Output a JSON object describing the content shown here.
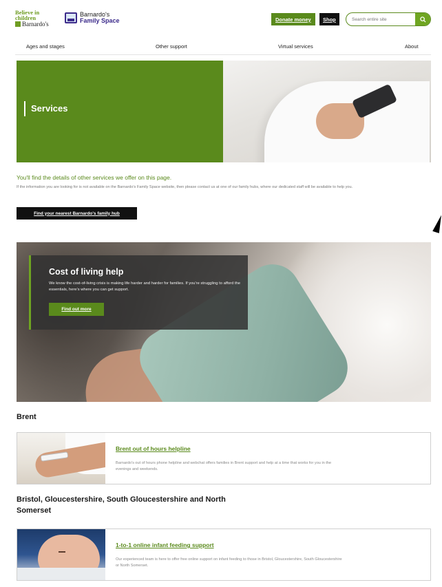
{
  "header": {
    "logo_tagline": "Believe in children",
    "logo_brand": "Barnardo's",
    "family_space_line1": "Barnardo's",
    "family_space_line2": "Family Space",
    "donate_label": "Donate money",
    "shop_label": "Shop",
    "search_placeholder": "Search entire site"
  },
  "nav": {
    "items": [
      {
        "label": "Ages and stages"
      },
      {
        "label": "Other support"
      },
      {
        "label": "Virtual services"
      },
      {
        "label": "About"
      }
    ]
  },
  "hero": {
    "title": "Services"
  },
  "intro": {
    "lead": "You'll find the details of other services we offer on this page.",
    "body": "If the information you are looking for is not available on the Barnardo's Family Space website, then please contact us at one of our family hubs, where our dedicated staff will be available to help you.",
    "hub_button": "Find your nearest Barnardo's family hub"
  },
  "cost_of_living": {
    "title": "Cost of living help",
    "body": "We know the cost-of-living crisis is making life harder and harder for families. If you're struggling to afford the essentials, here's where you can get support.",
    "button": "Find out more"
  },
  "sections": [
    {
      "title": "Brent",
      "card_title": "Brent out of hours helpline",
      "card_desc": "Barnardo's out of hours phone helpline and webchat offers families in Brent support and help at a time that works for you in the evenings and weekends."
    },
    {
      "title": "Bristol, Gloucestershire, South Gloucestershire and North Somerset",
      "card_title": "1-to-1 online infant feeding support",
      "card_desc": "Our experienced team is here to offer free online support on infant feeding to those in Bristol, Gloucestershire, South Gloucestershire or North Somerset."
    }
  ],
  "colors": {
    "brand_green": "#5a8a1c",
    "search_green": "#6fa521",
    "dark": "#111111"
  }
}
